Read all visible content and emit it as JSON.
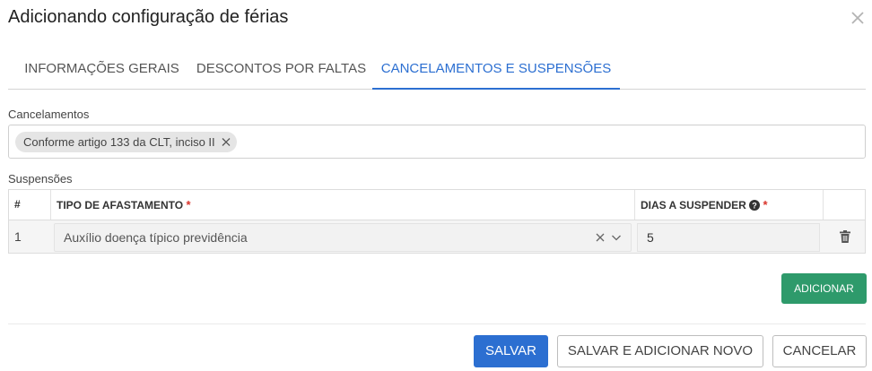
{
  "dialog": {
    "title": "Adicionando configuração de férias",
    "close_icon": "close-icon"
  },
  "tabs": [
    {
      "label": "INFORMAÇÕES GERAIS",
      "active": false
    },
    {
      "label": "DESCONTOS POR FALTAS",
      "active": false
    },
    {
      "label": "CANCELAMENTOS E SUSPENSÕES",
      "active": true
    }
  ],
  "cancelamentos": {
    "label": "Cancelamentos",
    "tags": [
      "Conforme artigo 133 da CLT, inciso II"
    ]
  },
  "suspensoes": {
    "label": "Suspensões",
    "columns": {
      "index": "#",
      "tipo": "TIPO DE AFASTAMENTO",
      "dias": "DIAS A SUSPENDER",
      "required_mark": "*"
    },
    "rows": [
      {
        "index": "1",
        "tipo": "Auxílio doença típico previdência",
        "dias": "5"
      }
    ],
    "add_label": "ADICIONAR"
  },
  "footer": {
    "save": "SALVAR",
    "save_new": "SALVAR E ADICIONAR NOVO",
    "cancel": "CANCELAR"
  },
  "colors": {
    "primary": "#2c6fd1",
    "success": "#2e9a6b",
    "required": "#d9342b"
  }
}
